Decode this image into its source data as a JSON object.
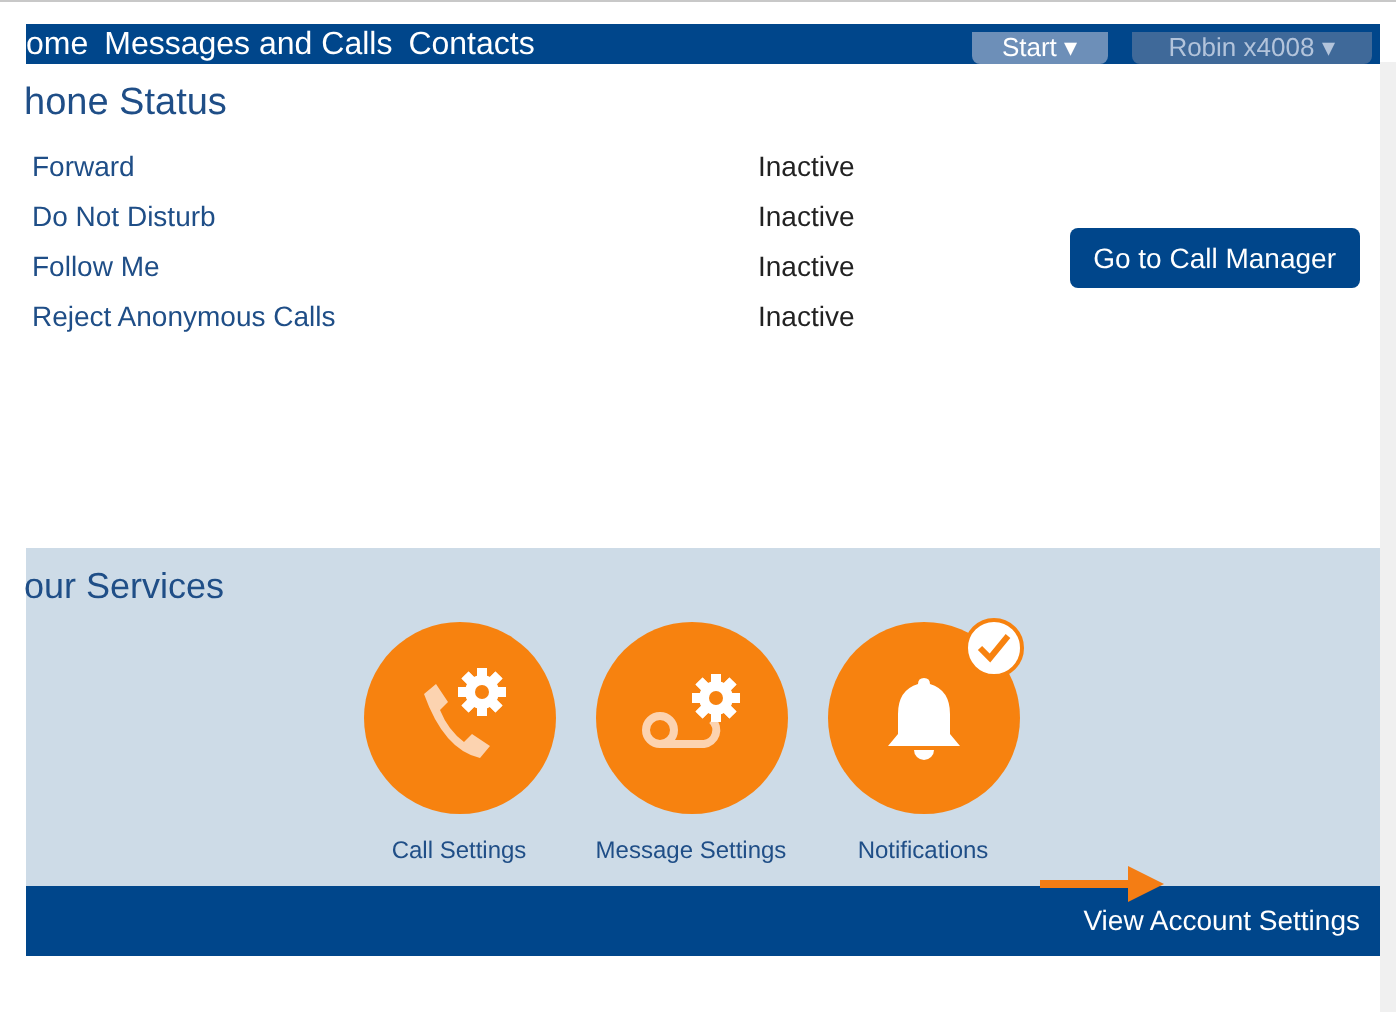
{
  "nav": {
    "links": [
      {
        "label": "ome"
      },
      {
        "label": "Messages and Calls"
      },
      {
        "label": "Contacts"
      }
    ],
    "start_menu": {
      "label": "Start ▾",
      "disabled": false
    },
    "user_menu": {
      "label": "Robin x4008 ▾",
      "disabled": true
    }
  },
  "phone_status": {
    "title": "hone Status",
    "rows": [
      {
        "feature": "Forward",
        "status": "Inactive"
      },
      {
        "feature": "Do Not Disturb",
        "status": "Inactive"
      },
      {
        "feature": "Follow Me",
        "status": "Inactive"
      },
      {
        "feature": "Reject Anonymous Calls",
        "status": "Inactive"
      }
    ],
    "button": "Go to Call Manager"
  },
  "services": {
    "title": "our Services",
    "items": [
      {
        "kind": "call",
        "label": "Call Settings",
        "checked": false
      },
      {
        "kind": "message",
        "label": "Message Settings",
        "checked": false
      },
      {
        "kind": "notification",
        "label": "Notifications",
        "checked": true
      }
    ]
  },
  "footer": {
    "link": "View Account Settings"
  }
}
